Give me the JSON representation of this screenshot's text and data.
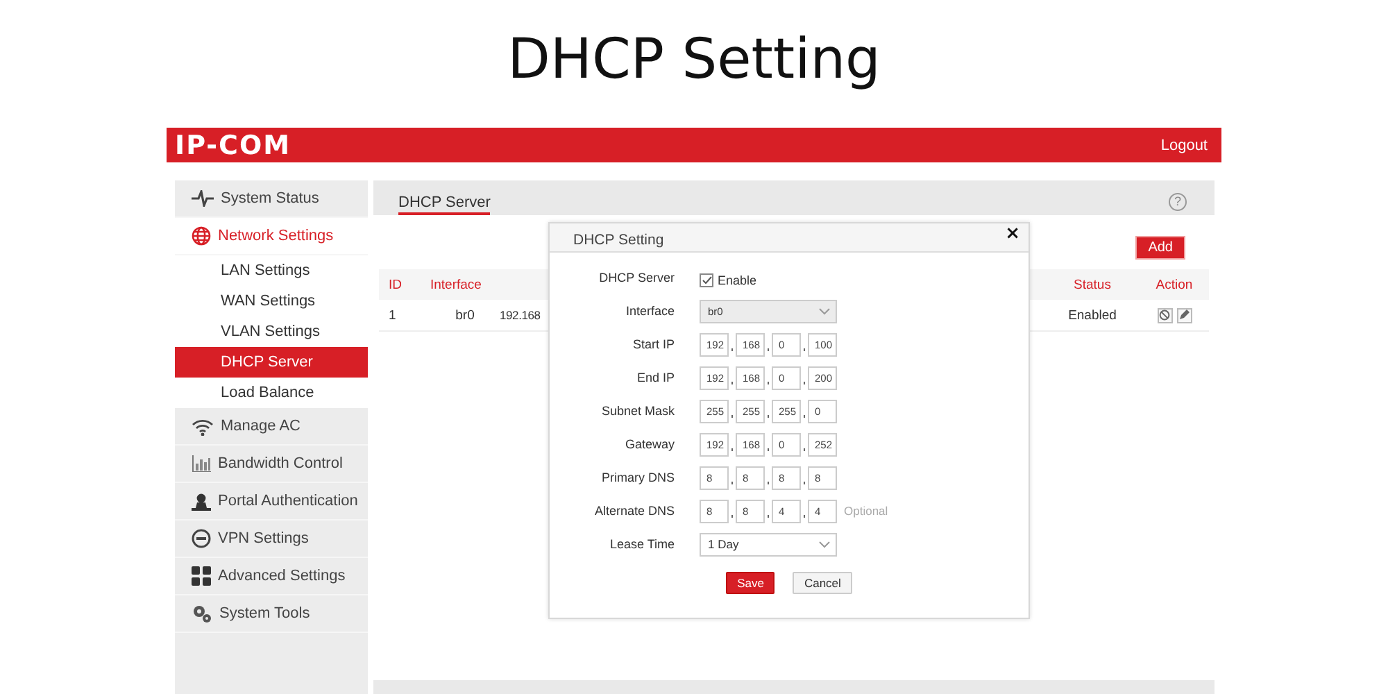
{
  "page_title": "DHCP Setting",
  "header": {
    "logo": "IP-COM",
    "logout": "Logout"
  },
  "sidebar": {
    "items": [
      {
        "label": "System Status",
        "expanded": false
      },
      {
        "label": "Network Settings",
        "expanded": true,
        "children": [
          {
            "label": "LAN Settings",
            "selected": false
          },
          {
            "label": "WAN Settings",
            "selected": false
          },
          {
            "label": "VLAN Settings",
            "selected": false
          },
          {
            "label": "DHCP Server",
            "selected": true
          },
          {
            "label": "Load Balance",
            "selected": false
          }
        ]
      },
      {
        "label": "Manage AC",
        "expanded": false
      },
      {
        "label": "Bandwidth Control",
        "expanded": false
      },
      {
        "label": "Portal Authentication",
        "expanded": false
      },
      {
        "label": "VPN Settings",
        "expanded": false
      },
      {
        "label": "Advanced Settings",
        "expanded": false
      },
      {
        "label": "System Tools",
        "expanded": false
      }
    ]
  },
  "content": {
    "tabs": [
      {
        "label": "DHCP Server",
        "selected": true
      }
    ],
    "help": "?",
    "add_button": "Add",
    "table": {
      "columns": [
        "ID",
        "Interface",
        "Status",
        "Action"
      ],
      "rows": [
        {
          "id": "1",
          "interface": "br0",
          "column_3": "192.168",
          "status": "Enabled"
        }
      ]
    }
  },
  "dialog": {
    "title": "DHCP Setting",
    "close": "×",
    "fields": [
      {
        "kind": "checkbox",
        "label": "DHCP Server",
        "text": "Enable",
        "checked": true
      },
      {
        "kind": "select",
        "label": "Interface",
        "value": "br0",
        "disabled": true
      },
      {
        "kind": "ip",
        "label": "Start IP",
        "octets": [
          "192",
          "168",
          "0",
          "100"
        ]
      },
      {
        "kind": "ip",
        "label": "End IP",
        "octets": [
          "192",
          "168",
          "0",
          "200"
        ]
      },
      {
        "kind": "ip",
        "label": "Subnet Mask",
        "octets": [
          "255",
          "255",
          "255",
          "0"
        ]
      },
      {
        "kind": "ip",
        "label": "Gateway",
        "octets": [
          "192",
          "168",
          "0",
          "252"
        ]
      },
      {
        "kind": "ip",
        "label": "Primary DNS",
        "octets": [
          "8",
          "8",
          "8",
          "8"
        ]
      },
      {
        "kind": "ip",
        "label": "Alternate DNS",
        "octets": [
          "8",
          "8",
          "4",
          "4"
        ],
        "hint": "Optional"
      },
      {
        "kind": "select",
        "label": "Lease Time",
        "value": "1 Day",
        "disabled": false
      }
    ],
    "buttons": [
      {
        "label": "Save",
        "kind": "primary"
      },
      {
        "label": "Cancel",
        "kind": "default"
      }
    ]
  }
}
